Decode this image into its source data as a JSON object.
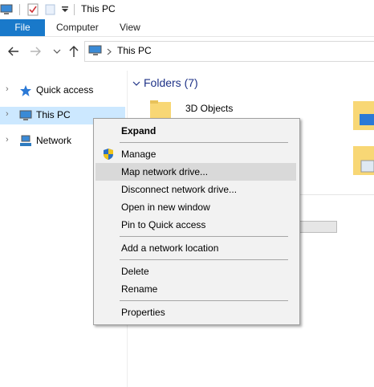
{
  "window": {
    "title": "This PC"
  },
  "ribbon": {
    "tabs": [
      "File",
      "Computer",
      "View"
    ]
  },
  "address": {
    "path_label": "This PC"
  },
  "nav": {
    "items": [
      {
        "label": "Quick access",
        "icon": "star-icon"
      },
      {
        "label": "This PC",
        "icon": "computer-icon",
        "selected": true
      },
      {
        "label": "Network",
        "icon": "network-icon"
      }
    ]
  },
  "content": {
    "folders_heading": "Folders (7)",
    "visible_folder": "3D Objects"
  },
  "context_menu": {
    "items": [
      {
        "label": "Expand",
        "bold": true
      },
      {
        "label": "Manage",
        "icon": "shield-icon"
      },
      {
        "label": "Map network drive...",
        "hover": true
      },
      {
        "label": "Disconnect network drive..."
      },
      {
        "label": "Open in new window"
      },
      {
        "label": "Pin to Quick access"
      },
      {
        "label": "Add a network location"
      },
      {
        "label": "Delete"
      },
      {
        "label": "Rename"
      },
      {
        "label": "Properties"
      }
    ]
  },
  "colors": {
    "file_tab": "#1979ca",
    "selection": "#cce8ff",
    "heading": "#1e3287",
    "folder": "#f8d775"
  }
}
